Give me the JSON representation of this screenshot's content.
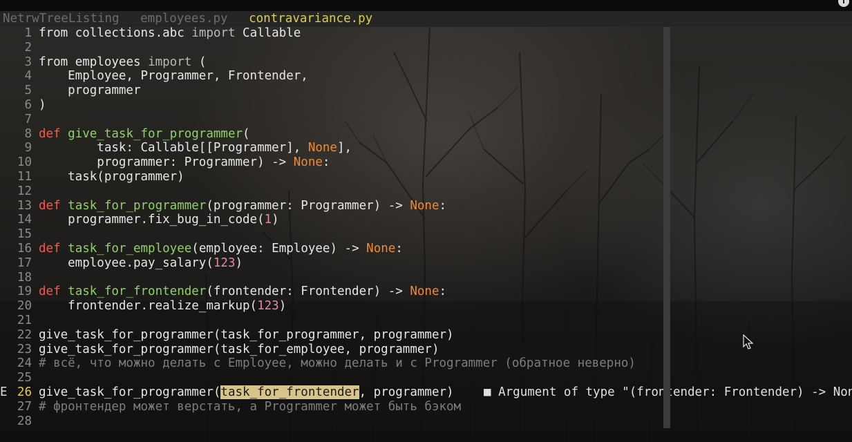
{
  "tabs": [
    {
      "label": "NetrwTreeListing",
      "active": false
    },
    {
      "label": "employees.py",
      "active": false
    },
    {
      "label": "contravariance.py",
      "active": true
    }
  ],
  "editor": {
    "current_line": 26,
    "lines": [
      {
        "n": "1",
        "tokens": [
          [
            "kw-import",
            "from"
          ],
          [
            "p",
            " collections.abc "
          ],
          [
            "imp",
            "import"
          ],
          [
            "p",
            " Callable"
          ]
        ]
      },
      {
        "n": "2",
        "tokens": []
      },
      {
        "n": "3",
        "tokens": [
          [
            "kw-import",
            "from"
          ],
          [
            "p",
            " employees "
          ],
          [
            "imp",
            "import"
          ],
          [
            "p",
            " ("
          ]
        ]
      },
      {
        "n": "4",
        "tokens": [
          [
            "p",
            "    Employee, Programmer, Frontender,"
          ]
        ]
      },
      {
        "n": "5",
        "tokens": [
          [
            "p",
            "    programmer"
          ]
        ]
      },
      {
        "n": "6",
        "tokens": [
          [
            "p",
            ")"
          ]
        ]
      },
      {
        "n": "7",
        "tokens": []
      },
      {
        "n": "8",
        "tokens": [
          [
            "kw",
            "def"
          ],
          [
            "p",
            " "
          ],
          [
            "fn",
            "give_task_for_programmer"
          ],
          [
            "p",
            "("
          ]
        ]
      },
      {
        "n": "9",
        "tokens": [
          [
            "p",
            "        task: Callable[[Programmer], "
          ],
          [
            "none",
            "None"
          ],
          [
            "p",
            "],"
          ]
        ]
      },
      {
        "n": "10",
        "tokens": [
          [
            "p",
            "        programmer: Programmer) -> "
          ],
          [
            "none",
            "None"
          ],
          [
            "p",
            ":"
          ]
        ]
      },
      {
        "n": "11",
        "tokens": [
          [
            "p",
            "    task(programmer)"
          ]
        ]
      },
      {
        "n": "12",
        "tokens": []
      },
      {
        "n": "13",
        "tokens": [
          [
            "kw",
            "def"
          ],
          [
            "p",
            " "
          ],
          [
            "fn",
            "task_for_programmer"
          ],
          [
            "p",
            "(programmer: Programmer) -> "
          ],
          [
            "none",
            "None"
          ],
          [
            "p",
            ":"
          ]
        ]
      },
      {
        "n": "14",
        "tokens": [
          [
            "p",
            "    programmer.fix_bug_in_code("
          ],
          [
            "num",
            "1"
          ],
          [
            "p",
            ")"
          ]
        ]
      },
      {
        "n": "15",
        "tokens": []
      },
      {
        "n": "16",
        "tokens": [
          [
            "kw",
            "def"
          ],
          [
            "p",
            " "
          ],
          [
            "fn",
            "task_for_employee"
          ],
          [
            "p",
            "(employee: Employee) -> "
          ],
          [
            "none",
            "None"
          ],
          [
            "p",
            ":"
          ]
        ]
      },
      {
        "n": "17",
        "tokens": [
          [
            "p",
            "    employee.pay_salary("
          ],
          [
            "num",
            "123"
          ],
          [
            "p",
            ")"
          ]
        ]
      },
      {
        "n": "18",
        "tokens": []
      },
      {
        "n": "19",
        "tokens": [
          [
            "kw",
            "def"
          ],
          [
            "p",
            " "
          ],
          [
            "fn",
            "task_for_frontender"
          ],
          [
            "p",
            "(frontender: Frontender) -> "
          ],
          [
            "none",
            "None"
          ],
          [
            "p",
            ":"
          ]
        ]
      },
      {
        "n": "20",
        "tokens": [
          [
            "p",
            "    frontender.realize_markup("
          ],
          [
            "num",
            "123"
          ],
          [
            "p",
            ")"
          ]
        ]
      },
      {
        "n": "21",
        "tokens": []
      },
      {
        "n": "22",
        "tokens": [
          [
            "p",
            "give_task_for_programmer(task_for_programmer, programmer)"
          ]
        ]
      },
      {
        "n": "23",
        "tokens": [
          [
            "p",
            "give_task_for_programmer(task_for_employee, programmer)"
          ]
        ]
      },
      {
        "n": "24",
        "tokens": [
          [
            "cmt",
            "# всё, что можно делать с Employee, можно делать и с Programmer (обратное неверно)"
          ]
        ]
      },
      {
        "n": "25",
        "tokens": []
      },
      {
        "n": "26",
        "tokens": [
          [
            "p",
            "give_task_for_programmer("
          ],
          [
            "hl",
            "task_for_frontender"
          ],
          [
            "p",
            ", programmer)"
          ]
        ],
        "sign": "E",
        "diagnostic": "Argument of type \"(frontender: Frontender) -> None"
      },
      {
        "n": "27",
        "tokens": [
          [
            "cmt",
            "# фронтендер может верстать, а Programmer может быть бэком"
          ]
        ]
      },
      {
        "n": "28",
        "tokens": []
      }
    ]
  },
  "diagnostic_marker": "■",
  "colors": {
    "keyword": "#f05a4e",
    "function": "#8fd06c",
    "none": "#f08a30",
    "number": "#e08aa0",
    "comment": "#7d7d7d",
    "highlight": "#d7c48a",
    "active_tab": "#d9cf52"
  },
  "icons": {
    "mouse_cursor": "arrow-pointer-icon",
    "diagnostic_sign": "error-sign-icon"
  }
}
